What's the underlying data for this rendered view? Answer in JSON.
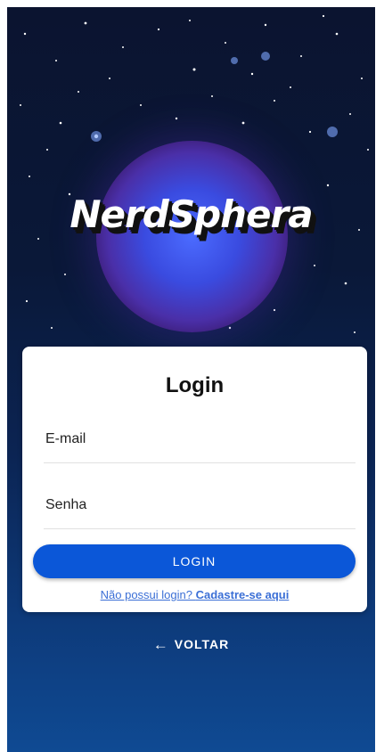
{
  "app": {
    "logo_text": "NerdSphera"
  },
  "login_card": {
    "title": "Login",
    "email_placeholder": "E-mail",
    "password_placeholder": "Senha",
    "login_button": "LOGIN",
    "signup_prompt": "Não possui login? ",
    "signup_link": "Cadastre-se aqui"
  },
  "back": {
    "icon": "arrow-left-icon",
    "label": "VOLTAR"
  },
  "colors": {
    "primary": "#0b57d8",
    "link": "#3b6fd6",
    "background_top": "#0b1430",
    "background_bottom": "#0f4a93"
  }
}
